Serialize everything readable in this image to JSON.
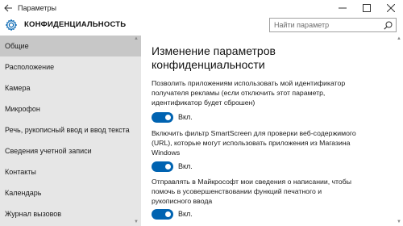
{
  "window": {
    "title": "Параметры",
    "back_icon": "back-arrow-icon",
    "minimize_icon": "minimize-icon",
    "maximize_icon": "maximize-icon",
    "close_icon": "close-icon"
  },
  "header": {
    "section_title": "КОНФИДЕНЦИАЛЬНОСТЬ",
    "icon": "gear-icon",
    "accent_color": "#0063b1"
  },
  "search": {
    "placeholder": "Найти параметр",
    "value": ""
  },
  "sidebar": {
    "items": [
      {
        "label": "Общие",
        "active": true
      },
      {
        "label": "Расположение",
        "active": false
      },
      {
        "label": "Камера",
        "active": false
      },
      {
        "label": "Микрофон",
        "active": false
      },
      {
        "label": "Речь, рукописный ввод и ввод текста",
        "active": false
      },
      {
        "label": "Сведения учетной записи",
        "active": false
      },
      {
        "label": "Контакты",
        "active": false
      },
      {
        "label": "Календарь",
        "active": false
      },
      {
        "label": "Журнал вызовов",
        "active": false
      }
    ]
  },
  "main": {
    "title": "Изменение параметров конфиденциальности",
    "settings": [
      {
        "description": "Позволить приложениям использовать мой идентификатор получателя рекламы (если отключить этот параметр, идентификатор будет сброшен)",
        "state_label": "Вкл.",
        "on": true
      },
      {
        "description": "Включить фильтр SmartScreen для проверки веб-содержимого (URL), которые могут использовать приложения из Магазина Windows",
        "state_label": "Вкл.",
        "on": true
      },
      {
        "description": "Отправлять в Майкрософт мои сведения о написании, чтобы помочь в усовершенствовании функций печатного и рукописного ввода",
        "state_label": "Вкл.",
        "on": true
      }
    ]
  }
}
